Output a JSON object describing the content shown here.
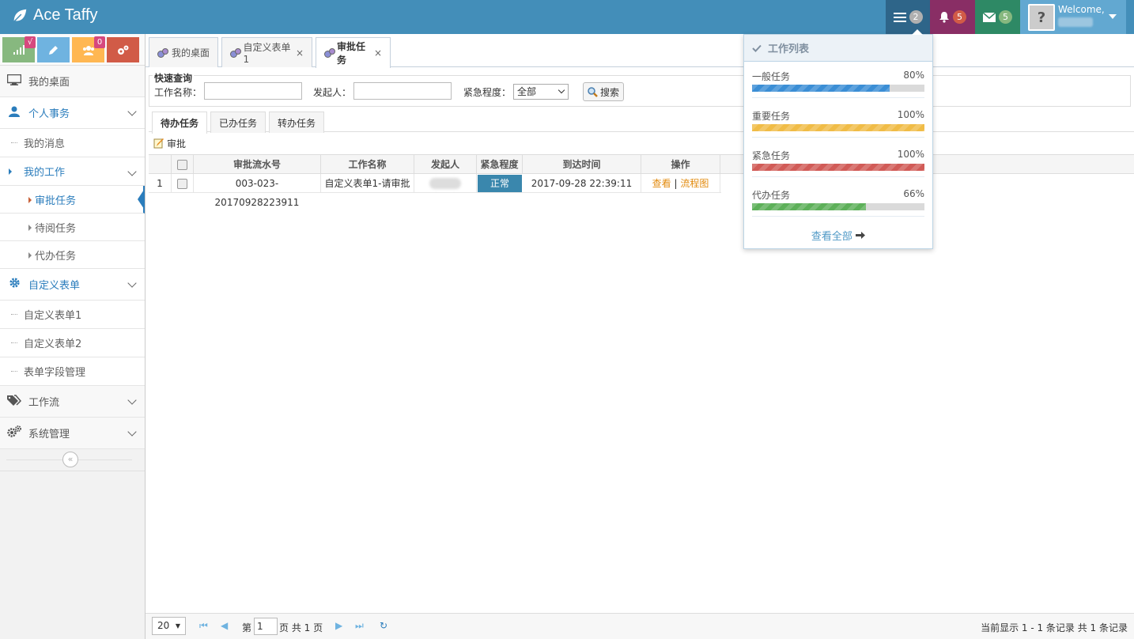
{
  "app": {
    "title": "Ace Taffy"
  },
  "navbar": {
    "tasks_count": "2",
    "notifications_count": "5",
    "messages_count": "5",
    "welcome": "Welcome,"
  },
  "shortcuts": {
    "badge1": "√",
    "badge3": "0"
  },
  "sidebar": {
    "desktop": "我的桌面",
    "personal": "个人事务",
    "my_messages": "我的消息",
    "my_work": "我的工作",
    "approval_tasks": "审批任务",
    "pending_read": "待阅任务",
    "proxy_tasks": "代办任务",
    "custom_forms": "自定义表单",
    "custom_form1": "自定义表单1",
    "custom_form2": "自定义表单2",
    "form_fields": "表单字段管理",
    "workflow": "工作流",
    "system": "系统管理",
    "collapse": "«"
  },
  "tabs": [
    {
      "label": "我的桌面"
    },
    {
      "label": "自定义表单1",
      "close": "×"
    },
    {
      "label": "审批任务",
      "close": "×"
    }
  ],
  "quick_search": {
    "legend": "快速查询",
    "work_name_label": "工作名称：",
    "initiator_label": "发起人：",
    "urgency_label": "紧急程度：",
    "urgency_value": "全部",
    "search_button": "搜索"
  },
  "sub_tabs": [
    "待办任务",
    "已办任务",
    "转办任务"
  ],
  "toolbar": {
    "approve": "审批"
  },
  "grid": {
    "headers": [
      "审批流水号",
      "工作名称",
      "发起人",
      "紧急程度",
      "到达时间",
      "操作"
    ],
    "rows": [
      {
        "index": "1",
        "serial": "003-023-20170928223911",
        "work_name": "自定义表单1-请审批",
        "urgency": "正常",
        "arrival": "2017-09-28 22:39:11",
        "view": "查看",
        "sep": "|",
        "flow": "流程图"
      }
    ]
  },
  "pager": {
    "page_size": "20",
    "page_prefix": "第",
    "page_value": "1",
    "page_suffix": "页 共 1 页",
    "info": "当前显示 1 - 1 条记录 共 1 条记录"
  },
  "task_dropdown": {
    "title": "工作列表",
    "items": [
      {
        "label": "一般任务",
        "percent": "80%",
        "value": 80,
        "color": "#3b8ed5"
      },
      {
        "label": "重要任务",
        "percent": "100%",
        "value": 100,
        "color": "#f0bc47"
      },
      {
        "label": "紧急任务",
        "percent": "100%",
        "value": 100,
        "color": "#d15b57"
      },
      {
        "label": "代办任务",
        "percent": "66%",
        "value": 66,
        "color": "#5db059"
      }
    ],
    "view_all": "查看全部"
  }
}
